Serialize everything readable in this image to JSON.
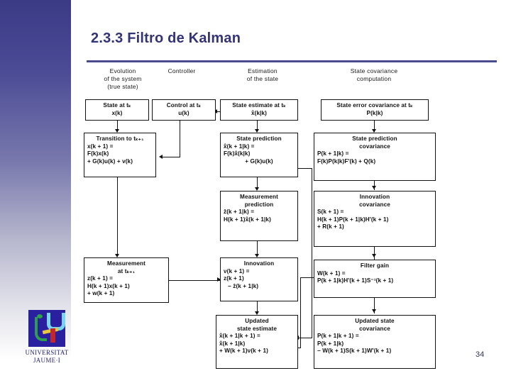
{
  "slide": {
    "title": "2.3.3 Filtro de Kalman",
    "page_number": "34",
    "accent_color": "#333377",
    "rule_color": "#4a4a8f",
    "sidebar_top_color": "#3a3a85",
    "sidebar_bottom_color": "#ffffff"
  },
  "logo": {
    "line1": "UNIVERSITAT",
    "line2": "JAUME·I",
    "mark_bg": "#2a1f9e",
    "text_color": "#262673"
  },
  "diagram": {
    "columns": [
      {
        "id": "evolution",
        "label_lines": [
          "Evolution",
          "of the system",
          "(true state)"
        ]
      },
      {
        "id": "controller",
        "label_lines": [
          "Controller"
        ]
      },
      {
        "id": "estimation",
        "label_lines": [
          "Estimation",
          "of the state"
        ]
      },
      {
        "id": "covariance",
        "label_lines": [
          "State covariance",
          "computation"
        ]
      }
    ],
    "nodes": {
      "state_k": {
        "header": [
          "State at tₖ"
        ],
        "equations": [
          "x(k)"
        ]
      },
      "control_k": {
        "header": [
          "Control at tₖ"
        ],
        "equations": [
          "u(k)"
        ]
      },
      "state_estimate_k": {
        "header": [
          "State estimate at tₖ"
        ],
        "equations": [
          "x̂(k|k)"
        ]
      },
      "state_error_cov_k": {
        "header": [
          "State error covariance at tₖ"
        ],
        "equations": [
          "P(k|k)"
        ]
      },
      "transition": {
        "header": [
          "Transition to tₖ₊₁"
        ],
        "equations": [
          "x(k + 1) =",
          "F(k)x(k)",
          "+ G(k)u(k) + v(k)"
        ]
      },
      "state_prediction": {
        "header": [
          "State prediction"
        ],
        "equations": [
          "x̂(k + 1|k) =",
          "F(k)x̂(k|k)",
          "+ G(k)u(k)"
        ]
      },
      "state_prediction_cov": {
        "header": [
          "State prediction",
          "covariance"
        ],
        "equations": [
          "P(k + 1|k) =",
          "F(k)P(k|k)F'(k) + Q(k)"
        ]
      },
      "measurement_prediction": {
        "header": [
          "Measurement",
          "prediction"
        ],
        "equations": [
          "ẑ(k + 1|k) =",
          "H(k + 1)x̂(k + 1|k)"
        ]
      },
      "innovation_cov": {
        "header": [
          "Innovation",
          "covariance"
        ],
        "equations": [
          "S(k + 1) =",
          "H(k + 1)P(k + 1|k)H'(k + 1)",
          "+ R(k + 1)"
        ]
      },
      "measurement": {
        "header": [
          "Measurement",
          "at tₖ₊₁"
        ],
        "equations": [
          "z(k + 1) =",
          "H(k + 1)x(k + 1)",
          "+ w(k + 1)"
        ]
      },
      "innovation": {
        "header": [
          "Innovation"
        ],
        "equations": [
          "ν(k + 1) =",
          "z(k + 1)",
          "− ẑ(k + 1|k)"
        ]
      },
      "filter_gain": {
        "header": [
          "Filter gain"
        ],
        "equations": [
          "W(k + 1) =",
          "P(k + 1|k)H'(k + 1)S⁻¹(k + 1)"
        ]
      },
      "updated_state_estimate": {
        "header": [
          "Updated",
          "state estimate"
        ],
        "equations": [
          "x̂(k + 1|k + 1) =",
          "x̂(k + 1|k)",
          "+ W(k + 1)ν(k + 1)"
        ]
      },
      "updated_state_cov": {
        "header": [
          "Updated state",
          "covariance"
        ],
        "equations": [
          "P(k + 1|k + 1) =",
          "P(k + 1|k)",
          "− W(k + 1)S(k + 1)W'(k + 1)"
        ]
      }
    }
  }
}
